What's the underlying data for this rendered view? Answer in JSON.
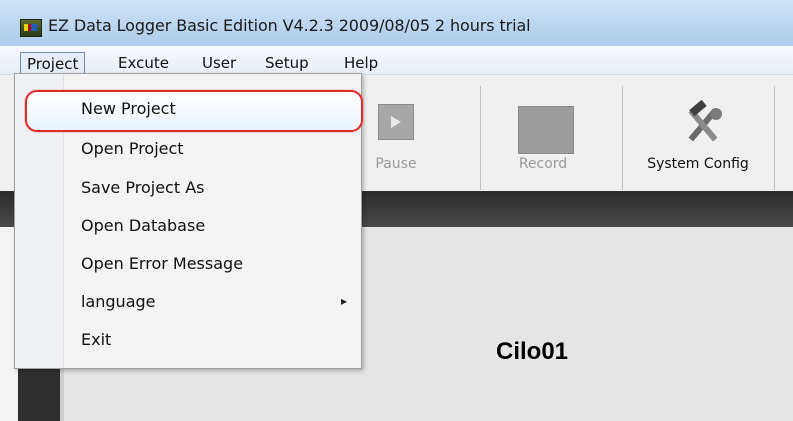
{
  "window": {
    "title": "EZ Data Logger Basic Edition V4.2.3 2009/08/05  2 hours trial"
  },
  "menubar": {
    "items": [
      "Project",
      "Excute",
      "User",
      "Setup",
      "Help"
    ],
    "active_index": 0
  },
  "toolbar": {
    "buttons": [
      {
        "label": "Pause",
        "enabled": false
      },
      {
        "label": "Record",
        "enabled": false
      },
      {
        "label": "System Config",
        "enabled": true
      }
    ]
  },
  "project_menu": {
    "items": [
      {
        "label": "New Project",
        "highlighted": true
      },
      {
        "label": "Open Project"
      },
      {
        "label": "Save Project As"
      },
      {
        "label": "Open Database"
      },
      {
        "label": "Open Error Message"
      },
      {
        "label": "language",
        "has_submenu": true
      },
      {
        "label": "Exit"
      }
    ],
    "submenu_arrow_icon": "chevron-right-icon"
  },
  "content": {
    "title": "Cilo01"
  },
  "colors": {
    "highlight_border": "#e12a2a",
    "darkband": "#2b2b2b"
  }
}
